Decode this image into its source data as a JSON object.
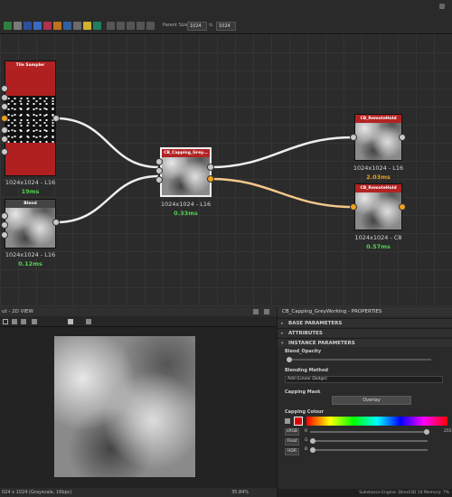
{
  "toolbar": {
    "parent_size_label": "Parent Size:",
    "size_w": "1024",
    "size_h": "1024",
    "link_symbol": "⇆",
    "icons": [
      "graph-icon",
      "frame-icon",
      "comment-icon",
      "pin-icon",
      "color-icon",
      "layout-icon",
      "align-icon",
      "sort-icon",
      "display-icon",
      "bake-icon"
    ]
  },
  "nodes": {
    "tile_sampler": {
      "title": "Tile Sampler",
      "size": "1024x1024 - L16",
      "time": "19ms"
    },
    "blend": {
      "title": "Blend",
      "size": "1024x1024 - L16",
      "time": "0.12ms"
    },
    "capping": {
      "title": "CB_Capping_Grey...",
      "size": "1024x1024 - L16",
      "time": "0.33ms"
    },
    "remote_a": {
      "title": "CB_RemoteHold",
      "size": "1024x1024 - L16",
      "time": "2.03ms"
    },
    "remote_b": {
      "title": "CB_RemoteHold",
      "size": "1024x1024 - C8",
      "time": "0.57ms"
    }
  },
  "view2d": {
    "title": "ut - 2D VIEW",
    "status": "024 x 1024 (Grayscale, 16bpc)",
    "zoom": "35.84%"
  },
  "properties": {
    "title": "CB_Capping_GreyWorking - PROPERTIES",
    "sections": [
      "BASE PARAMETERS",
      "ATTRIBUTES",
      "INSTANCE PARAMETERS"
    ],
    "blend_opacity_label": "Blend_Opacity",
    "blending_method_label": "Blending Method",
    "blending_method_value": "Add (Linear Dodge)",
    "capping_mask_label": "Capping Mask",
    "capping_mask_value": "Overlay",
    "capping_colour_label": "Capping Colour",
    "mode_rgb": "sRGB",
    "mode_float": "Float",
    "mode_hdr": "HDR",
    "channel_r": "R",
    "channel_g": "G",
    "channel_b": "B",
    "value_r": "255",
    "capping_colour": "#e00000"
  },
  "statusbar": {
    "text": "Substance Engine: Direct3D 10  Memory: 7%"
  }
}
